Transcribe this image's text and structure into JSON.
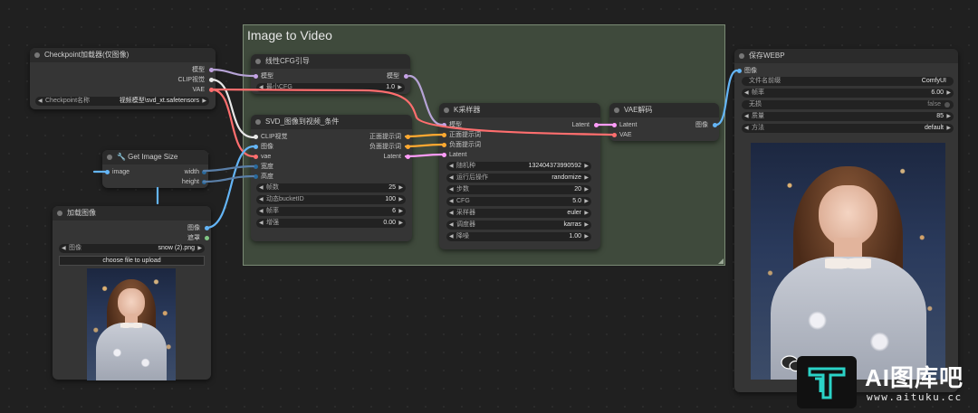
{
  "group": {
    "title": "Image to Video"
  },
  "checkpoint": {
    "title": "Checkpoint加载器(仅图像)",
    "outputs": [
      "模型",
      "CLIP视觉",
      "VAE"
    ],
    "widget": {
      "label": "Checkpoint名称",
      "value": "视频模型\\svd_xt.safetensors"
    }
  },
  "get_size": {
    "title": "🔧 Get Image Size",
    "input": "image",
    "outputs": [
      "width",
      "height"
    ]
  },
  "load_image": {
    "title": "加载图像",
    "outputs": [
      "图像",
      "遮罩"
    ],
    "widget": {
      "label": "图像",
      "value": "snow (2).png"
    },
    "button": "choose file to upload"
  },
  "cfg_guide": {
    "title": "线性CFG引导",
    "input": "模型",
    "output": "模型",
    "widget": {
      "label": "最小CFG",
      "value": "1.0"
    }
  },
  "svd_cond": {
    "title": "SVD_图像到视频_条件",
    "inputs": [
      "CLIP视觉",
      "图像",
      "vae",
      "宽度",
      "高度"
    ],
    "outputs": [
      "正面提示词",
      "负面提示词",
      "Latent"
    ],
    "widgets": [
      {
        "label": "帧数",
        "value": "25"
      },
      {
        "label": "动态bucketID",
        "value": "100"
      },
      {
        "label": "帧率",
        "value": "6"
      },
      {
        "label": "增强",
        "value": "0.00"
      }
    ]
  },
  "ksampler": {
    "title": "K采样器",
    "inputs": [
      "模型",
      "正面提示词",
      "负面提示词",
      "Latent"
    ],
    "output": "Latent",
    "widgets": [
      {
        "label": "随机种",
        "value": "132404373990592"
      },
      {
        "label": "运行后操作",
        "value": "randomize"
      },
      {
        "label": "步数",
        "value": "20"
      },
      {
        "label": "CFG",
        "value": "5.0"
      },
      {
        "label": "采样器",
        "value": "euler"
      },
      {
        "label": "调度器",
        "value": "karras"
      },
      {
        "label": "降噪",
        "value": "1.00"
      }
    ]
  },
  "vae_decode": {
    "title": "VAE解码",
    "inputs": [
      "Latent",
      "VAE"
    ],
    "output": "图像"
  },
  "save_webp": {
    "title": "保存WEBP",
    "input": "图像",
    "widgets": [
      {
        "label": "文件名前缀",
        "value": "ComfyUI"
      },
      {
        "label": "帧率",
        "value": "6.00"
      },
      {
        "label": "无损",
        "value": "false"
      },
      {
        "label": "质量",
        "value": "85"
      },
      {
        "label": "方法",
        "value": "default"
      }
    ]
  },
  "watermark": {
    "brand": "AI图库吧",
    "url": "www.aituku.cc"
  },
  "colors": {
    "clip": "#c6a2e6",
    "image": "#64b5f6",
    "vae": "#ff6e6e",
    "cond": "#ffa931",
    "latent": "#ff9cf9",
    "int": "#29699c",
    "mask": "#81c784"
  }
}
